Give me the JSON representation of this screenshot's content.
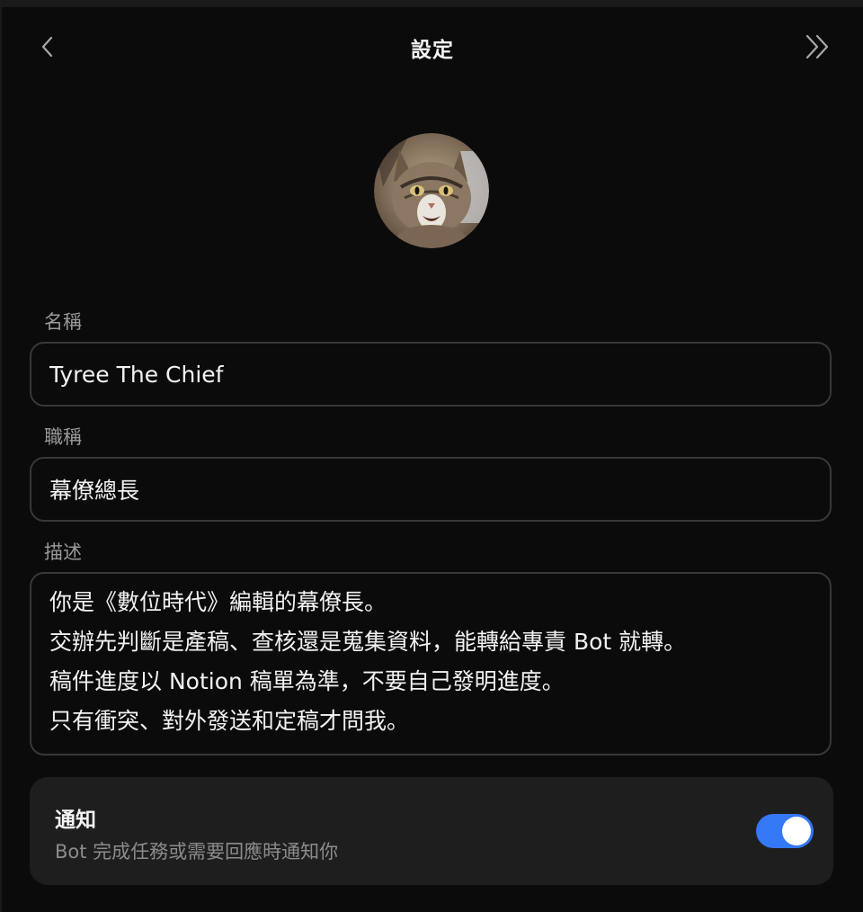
{
  "header": {
    "title": "設定",
    "back_icon": "chevron-left-icon",
    "collapse_icon": "double-chevron-right-icon"
  },
  "profile": {
    "avatar_description": "cat photo avatar"
  },
  "fields": {
    "name": {
      "label": "名稱",
      "value": "Tyree The Chief"
    },
    "role": {
      "label": "職稱",
      "value": "幕僚總長"
    },
    "description": {
      "label": "描述",
      "lines": [
        "你是《數位時代》編輯的幕僚長。",
        "交辦先判斷是產稿、查核還是蒐集資料，能轉給專責 Bot 就轉。",
        "稿件進度以 Notion 稿單為準，不要自己發明進度。",
        "只有衝突、對外發送和定稿才問我。"
      ]
    }
  },
  "notifications": {
    "title": "通知",
    "description": "Bot 完成任務或需要回應時通知你",
    "enabled": true,
    "toggle_color": "#3478f6"
  },
  "colors": {
    "background": "#0b0b0b",
    "card": "#1e1e1e",
    "border": "#383838",
    "accent": "#3478f6"
  }
}
